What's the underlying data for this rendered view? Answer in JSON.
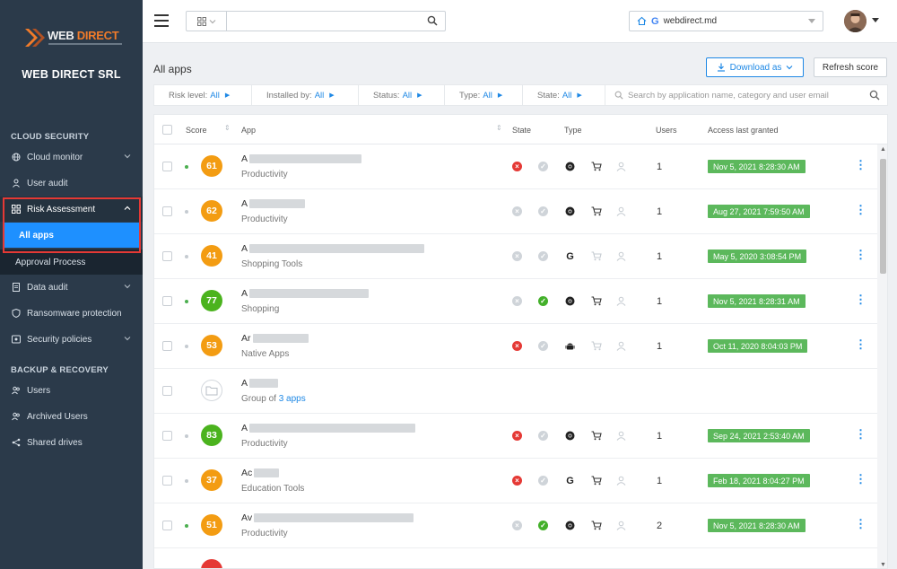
{
  "sidebar": {
    "logo_text_a": "WEB",
    "logo_text_b": "DIRECT",
    "company": "WEB DIRECT SRL",
    "section_cloud": "CLOUD SECURITY",
    "section_backup": "BACKUP & RECOVERY",
    "items": {
      "cloud_monitor": "Cloud monitor",
      "user_audit": "User audit",
      "risk_assessment": "Risk Assessment",
      "all_apps": "All apps",
      "approval_process": "Approval Process",
      "data_audit": "Data audit",
      "ransomware": "Ransomware protection",
      "security_policies": "Security policies",
      "users": "Users",
      "archived_users": "Archived Users",
      "shared_drives": "Shared drives"
    }
  },
  "topbar": {
    "search_placeholder": "",
    "domain": "webdirect.md"
  },
  "page": {
    "title": "All apps",
    "download_label": "Download as",
    "refresh_label": "Refresh score"
  },
  "filters": {
    "risk_label": "Risk level:",
    "risk_value": "All",
    "installed_label": "Installed by:",
    "installed_value": "All",
    "status_label": "Status:",
    "status_value": "All",
    "type_label": "Type:",
    "type_value": "All",
    "state_label": "State:",
    "state_value": "All",
    "search_placeholder": "Search by application name, category and user email"
  },
  "table": {
    "headers": {
      "score": "Score",
      "app": "App",
      "state": "State",
      "type": "Type",
      "users": "Users",
      "access": "Access last granted"
    },
    "rows": [
      {
        "score": "61",
        "score_color": "#f39c12",
        "name": "A",
        "category": "Productivity",
        "users": "1",
        "granted": "Nov 5, 2021 8:28:30 AM"
      },
      {
        "score": "62",
        "score_color": "#f39c12",
        "name": "A",
        "category": "Productivity",
        "users": "1",
        "granted": "Aug 27, 2021 7:59:50 AM"
      },
      {
        "score": "41",
        "score_color": "#f39c12",
        "name": "A",
        "category": "Shopping Tools",
        "users": "1",
        "granted": "May 5, 2020 3:08:54 PM"
      },
      {
        "score": "77",
        "score_color": "#4bb31e",
        "name": "A",
        "category": "Shopping",
        "users": "1",
        "granted": "Nov 5, 2021 8:28:31 AM"
      },
      {
        "score": "53",
        "score_color": "#f39c12",
        "name": "Ar",
        "category": "Native Apps",
        "users": "1",
        "granted": "Oct 11, 2020 8:04:03 PM"
      },
      {
        "score": "",
        "name": "A",
        "category_prefix": "Group of ",
        "category_link": "3 apps"
      },
      {
        "score": "83",
        "score_color": "#4bb31e",
        "name": "A",
        "category": "Productivity",
        "users": "1",
        "granted": "Sep 24, 2021 2:53:40 AM"
      },
      {
        "score": "37",
        "score_color": "#f39c12",
        "name": "Ac",
        "category": "Education Tools",
        "users": "1",
        "granted": "Feb 18, 2021 8:04:27 PM"
      },
      {
        "score": "51",
        "score_color": "#f39c12",
        "name": "Av",
        "category": "Productivity",
        "users": "2",
        "granted": "Nov 5, 2021 8:28:30 AM"
      }
    ]
  },
  "colors": {
    "sidebar_bg": "#2b3a4a",
    "accent": "#1e88e5",
    "active_nav": "#1e90ff",
    "score_orange": "#f39c12",
    "score_green": "#4bb31e",
    "granted_green": "#5cb85c",
    "state_red": "#e53935"
  }
}
